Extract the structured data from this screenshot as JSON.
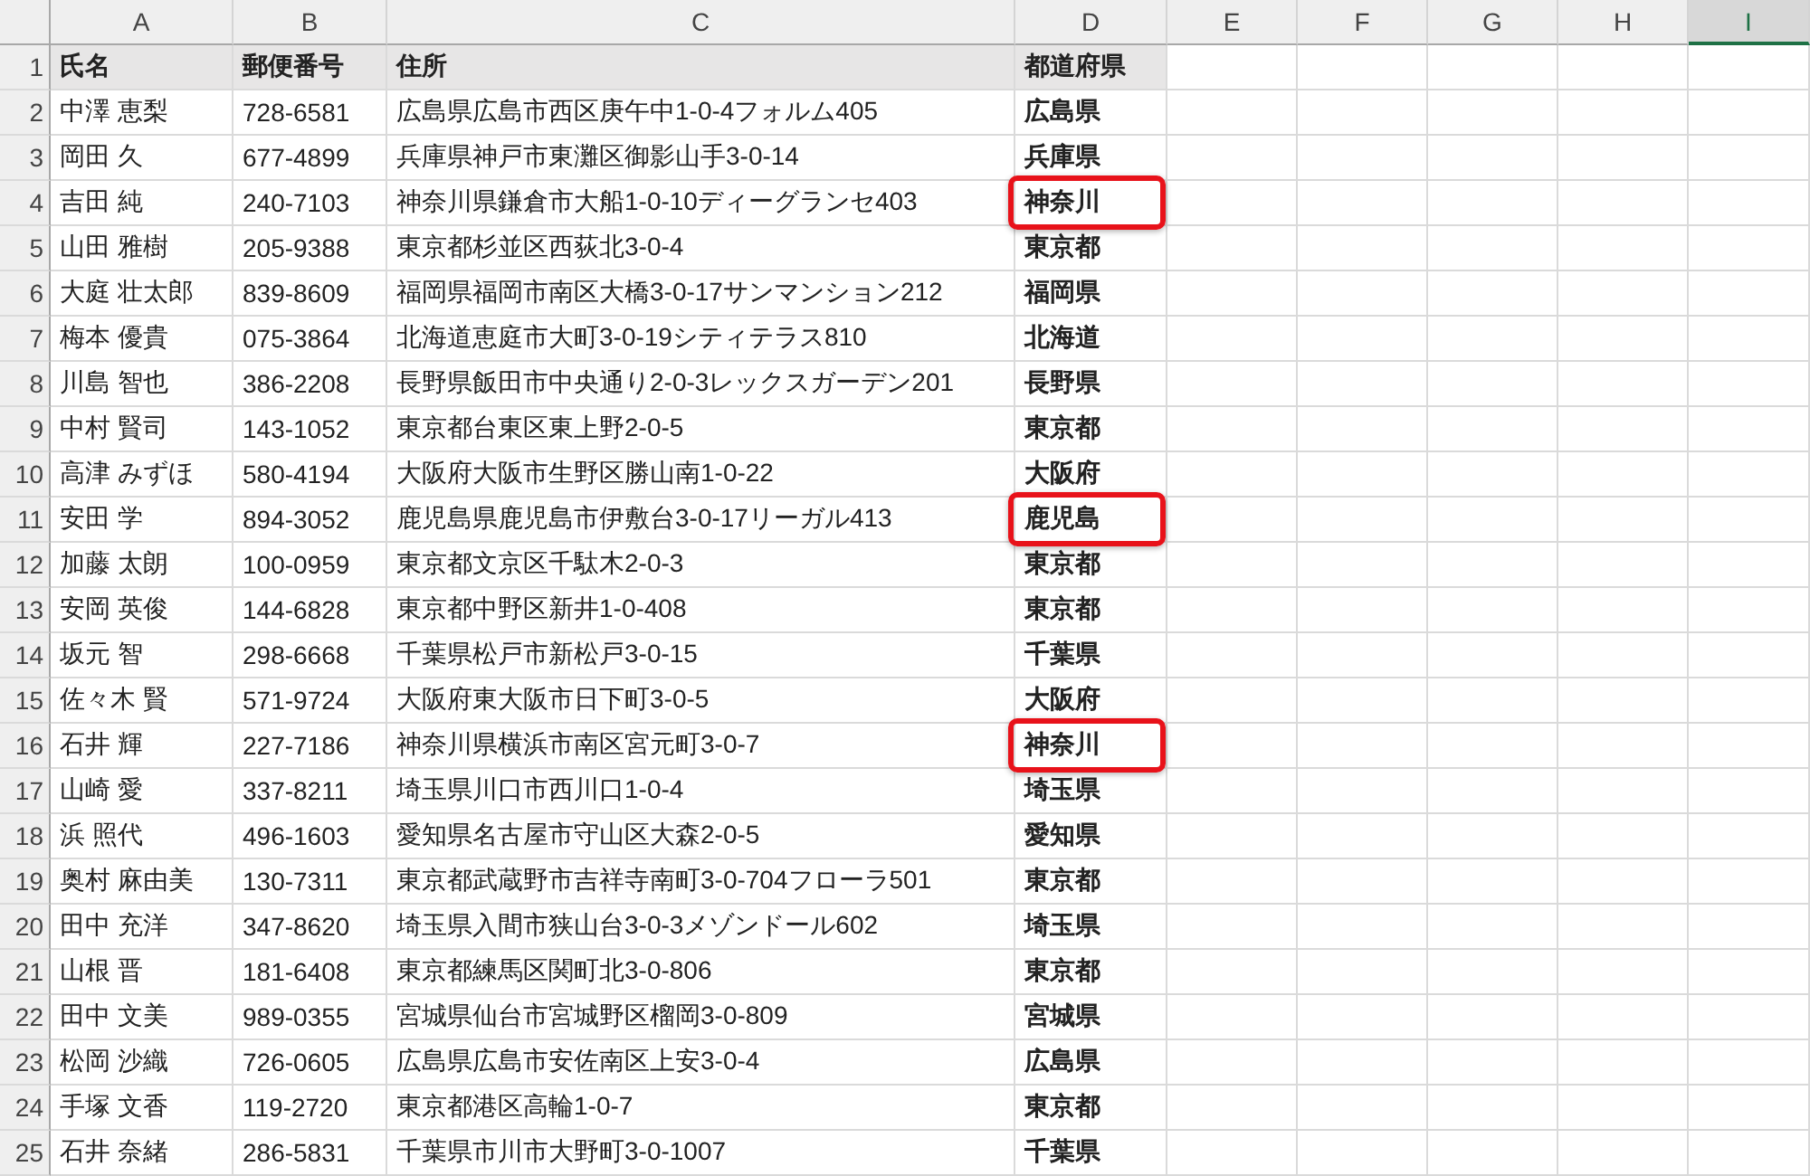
{
  "columns": [
    {
      "label": "A",
      "selected": false
    },
    {
      "label": "B",
      "selected": false
    },
    {
      "label": "C",
      "selected": false
    },
    {
      "label": "D",
      "selected": false
    },
    {
      "label": "E",
      "selected": false
    },
    {
      "label": "F",
      "selected": false
    },
    {
      "label": "G",
      "selected": false
    },
    {
      "label": "H",
      "selected": false
    },
    {
      "label": "I",
      "selected": true
    }
  ],
  "header_row": {
    "number": "1",
    "cells": [
      "氏名",
      "郵便番号",
      "住所",
      "都道府県"
    ]
  },
  "rows": [
    {
      "number": "2",
      "name": "中澤 恵梨",
      "postal": "728-6581",
      "address": "広島県広島市西区庚午中1-0-4フォルム405",
      "prefecture": "広島県",
      "highlighted": false
    },
    {
      "number": "3",
      "name": "岡田 久",
      "postal": "677-4899",
      "address": "兵庫県神戸市東灘区御影山手3-0-14",
      "prefecture": "兵庫県",
      "highlighted": false
    },
    {
      "number": "4",
      "name": "吉田 純",
      "postal": "240-7103",
      "address": "神奈川県鎌倉市大船1-0-10ディーグランセ403",
      "prefecture": "神奈川",
      "highlighted": true
    },
    {
      "number": "5",
      "name": "山田 雅樹",
      "postal": "205-9388",
      "address": "東京都杉並区西荻北3-0-4",
      "prefecture": "東京都",
      "highlighted": false
    },
    {
      "number": "6",
      "name": "大庭 壮太郎",
      "postal": "839-8609",
      "address": "福岡県福岡市南区大橋3-0-17サンマンション212",
      "prefecture": "福岡県",
      "highlighted": false
    },
    {
      "number": "7",
      "name": "梅本 優貴",
      "postal": "075-3864",
      "address": "北海道恵庭市大町3-0-19シティテラス810",
      "prefecture": "北海道",
      "highlighted": false
    },
    {
      "number": "8",
      "name": "川島 智也",
      "postal": "386-2208",
      "address": "長野県飯田市中央通り2-0-3レックスガーデン201",
      "prefecture": "長野県",
      "highlighted": false
    },
    {
      "number": "9",
      "name": "中村 賢司",
      "postal": "143-1052",
      "address": "東京都台東区東上野2-0-5",
      "prefecture": "東京都",
      "highlighted": false
    },
    {
      "number": "10",
      "name": "高津 みずほ",
      "postal": "580-4194",
      "address": "大阪府大阪市生野区勝山南1-0-22",
      "prefecture": "大阪府",
      "highlighted": false
    },
    {
      "number": "11",
      "name": "安田 学",
      "postal": "894-3052",
      "address": "鹿児島県鹿児島市伊敷台3-0-17リーガル413",
      "prefecture": "鹿児島",
      "highlighted": true
    },
    {
      "number": "12",
      "name": "加藤 太朗",
      "postal": "100-0959",
      "address": "東京都文京区千駄木2-0-3",
      "prefecture": "東京都",
      "highlighted": false
    },
    {
      "number": "13",
      "name": "安岡 英俊",
      "postal": "144-6828",
      "address": "東京都中野区新井1-0-408",
      "prefecture": "東京都",
      "highlighted": false
    },
    {
      "number": "14",
      "name": "坂元 智",
      "postal": "298-6668",
      "address": "千葉県松戸市新松戸3-0-15",
      "prefecture": "千葉県",
      "highlighted": false
    },
    {
      "number": "15",
      "name": "佐々木 賢",
      "postal": "571-9724",
      "address": "大阪府東大阪市日下町3-0-5",
      "prefecture": "大阪府",
      "highlighted": false
    },
    {
      "number": "16",
      "name": "石井 輝",
      "postal": "227-7186",
      "address": "神奈川県横浜市南区宮元町3-0-7",
      "prefecture": "神奈川",
      "highlighted": true
    },
    {
      "number": "17",
      "name": "山崎 愛",
      "postal": "337-8211",
      "address": "埼玉県川口市西川口1-0-4",
      "prefecture": "埼玉県",
      "highlighted": false
    },
    {
      "number": "18",
      "name": "浜 照代",
      "postal": "496-1603",
      "address": "愛知県名古屋市守山区大森2-0-5",
      "prefecture": "愛知県",
      "highlighted": false
    },
    {
      "number": "19",
      "name": "奥村 麻由美",
      "postal": "130-7311",
      "address": "東京都武蔵野市吉祥寺南町3-0-704フローラ501",
      "prefecture": "東京都",
      "highlighted": false
    },
    {
      "number": "20",
      "name": "田中 充洋",
      "postal": "347-8620",
      "address": "埼玉県入間市狭山台3-0-3メゾンドール602",
      "prefecture": "埼玉県",
      "highlighted": false
    },
    {
      "number": "21",
      "name": "山根 晋",
      "postal": "181-6408",
      "address": "東京都練馬区関町北3-0-806",
      "prefecture": "東京都",
      "highlighted": false
    },
    {
      "number": "22",
      "name": "田中 文美",
      "postal": "989-0355",
      "address": "宮城県仙台市宮城野区榴岡3-0-809",
      "prefecture": "宮城県",
      "highlighted": false
    },
    {
      "number": "23",
      "name": "松岡 沙織",
      "postal": "726-0605",
      "address": "広島県広島市安佐南区上安3-0-4",
      "prefecture": "広島県",
      "highlighted": false
    },
    {
      "number": "24",
      "name": "手塚 文香",
      "postal": "119-2720",
      "address": "東京都港区高輪1-0-7",
      "prefecture": "東京都",
      "highlighted": false
    },
    {
      "number": "25",
      "name": "石井 奈緒",
      "postal": "286-5831",
      "address": "千葉県市川市大野町3-0-1007",
      "prefecture": "千葉県",
      "highlighted": false
    }
  ]
}
